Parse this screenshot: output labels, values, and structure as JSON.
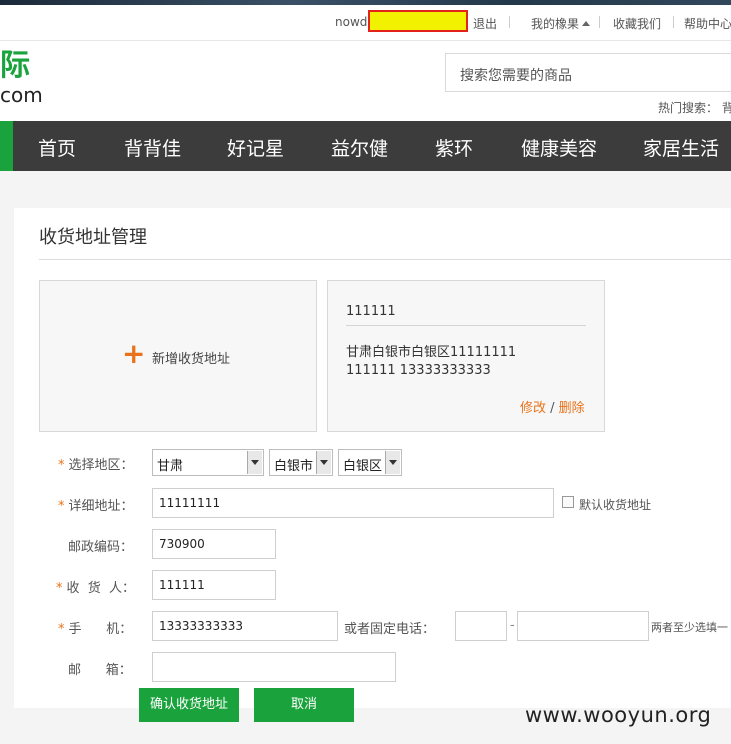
{
  "topbar": {
    "username_partial": "nowd",
    "logout": "退出",
    "my_xiangguo": "我的橡果",
    "favorites": "收藏我们",
    "help": "帮助中心"
  },
  "logo": {
    "top": "际",
    "bottom": "com"
  },
  "search": {
    "placeholder": "搜索您需要的商品"
  },
  "hot_search": {
    "label": "热门搜索：",
    "first": "背"
  },
  "nav": {
    "items": [
      "首页",
      "背背佳",
      "好记星",
      "益尔健",
      "紫环",
      "健康美容",
      "家居生活"
    ]
  },
  "page": {
    "title": "收货地址管理"
  },
  "add_card": {
    "icon": "plus-icon",
    "label": "新增收货地址"
  },
  "address_card": {
    "name": "111111",
    "detail": "甘肃白银市白银区11111111",
    "phone_line": "111111 13333333333",
    "edit": "修改",
    "separator": " / ",
    "delete": "删除"
  },
  "form": {
    "region_label": "选择地区：",
    "province": "甘肃",
    "city": "白银市",
    "district": "白银区",
    "detail_label": "详细地址：",
    "detail_value": "11111111",
    "default_label": "默认收货地址",
    "zip_label": "邮政编码：",
    "zip_value": "730900",
    "receiver_label": "收  货  人：",
    "receiver_value": "111111",
    "mobile_label": "手      机：",
    "mobile_value": "13333333333",
    "phone_label": "或者固定电话：",
    "phone_dash": "-",
    "phone_note": "两者至少选填一",
    "email_label": "邮      箱：",
    "email_value": "",
    "confirm_button": "确认收货地址",
    "cancel_button": "取消"
  },
  "watermark": "www.wooyun.org",
  "colors": {
    "brand_green": "#1aa33c",
    "accent_orange": "#e8731a",
    "nav_bg": "#3c3c3c"
  }
}
